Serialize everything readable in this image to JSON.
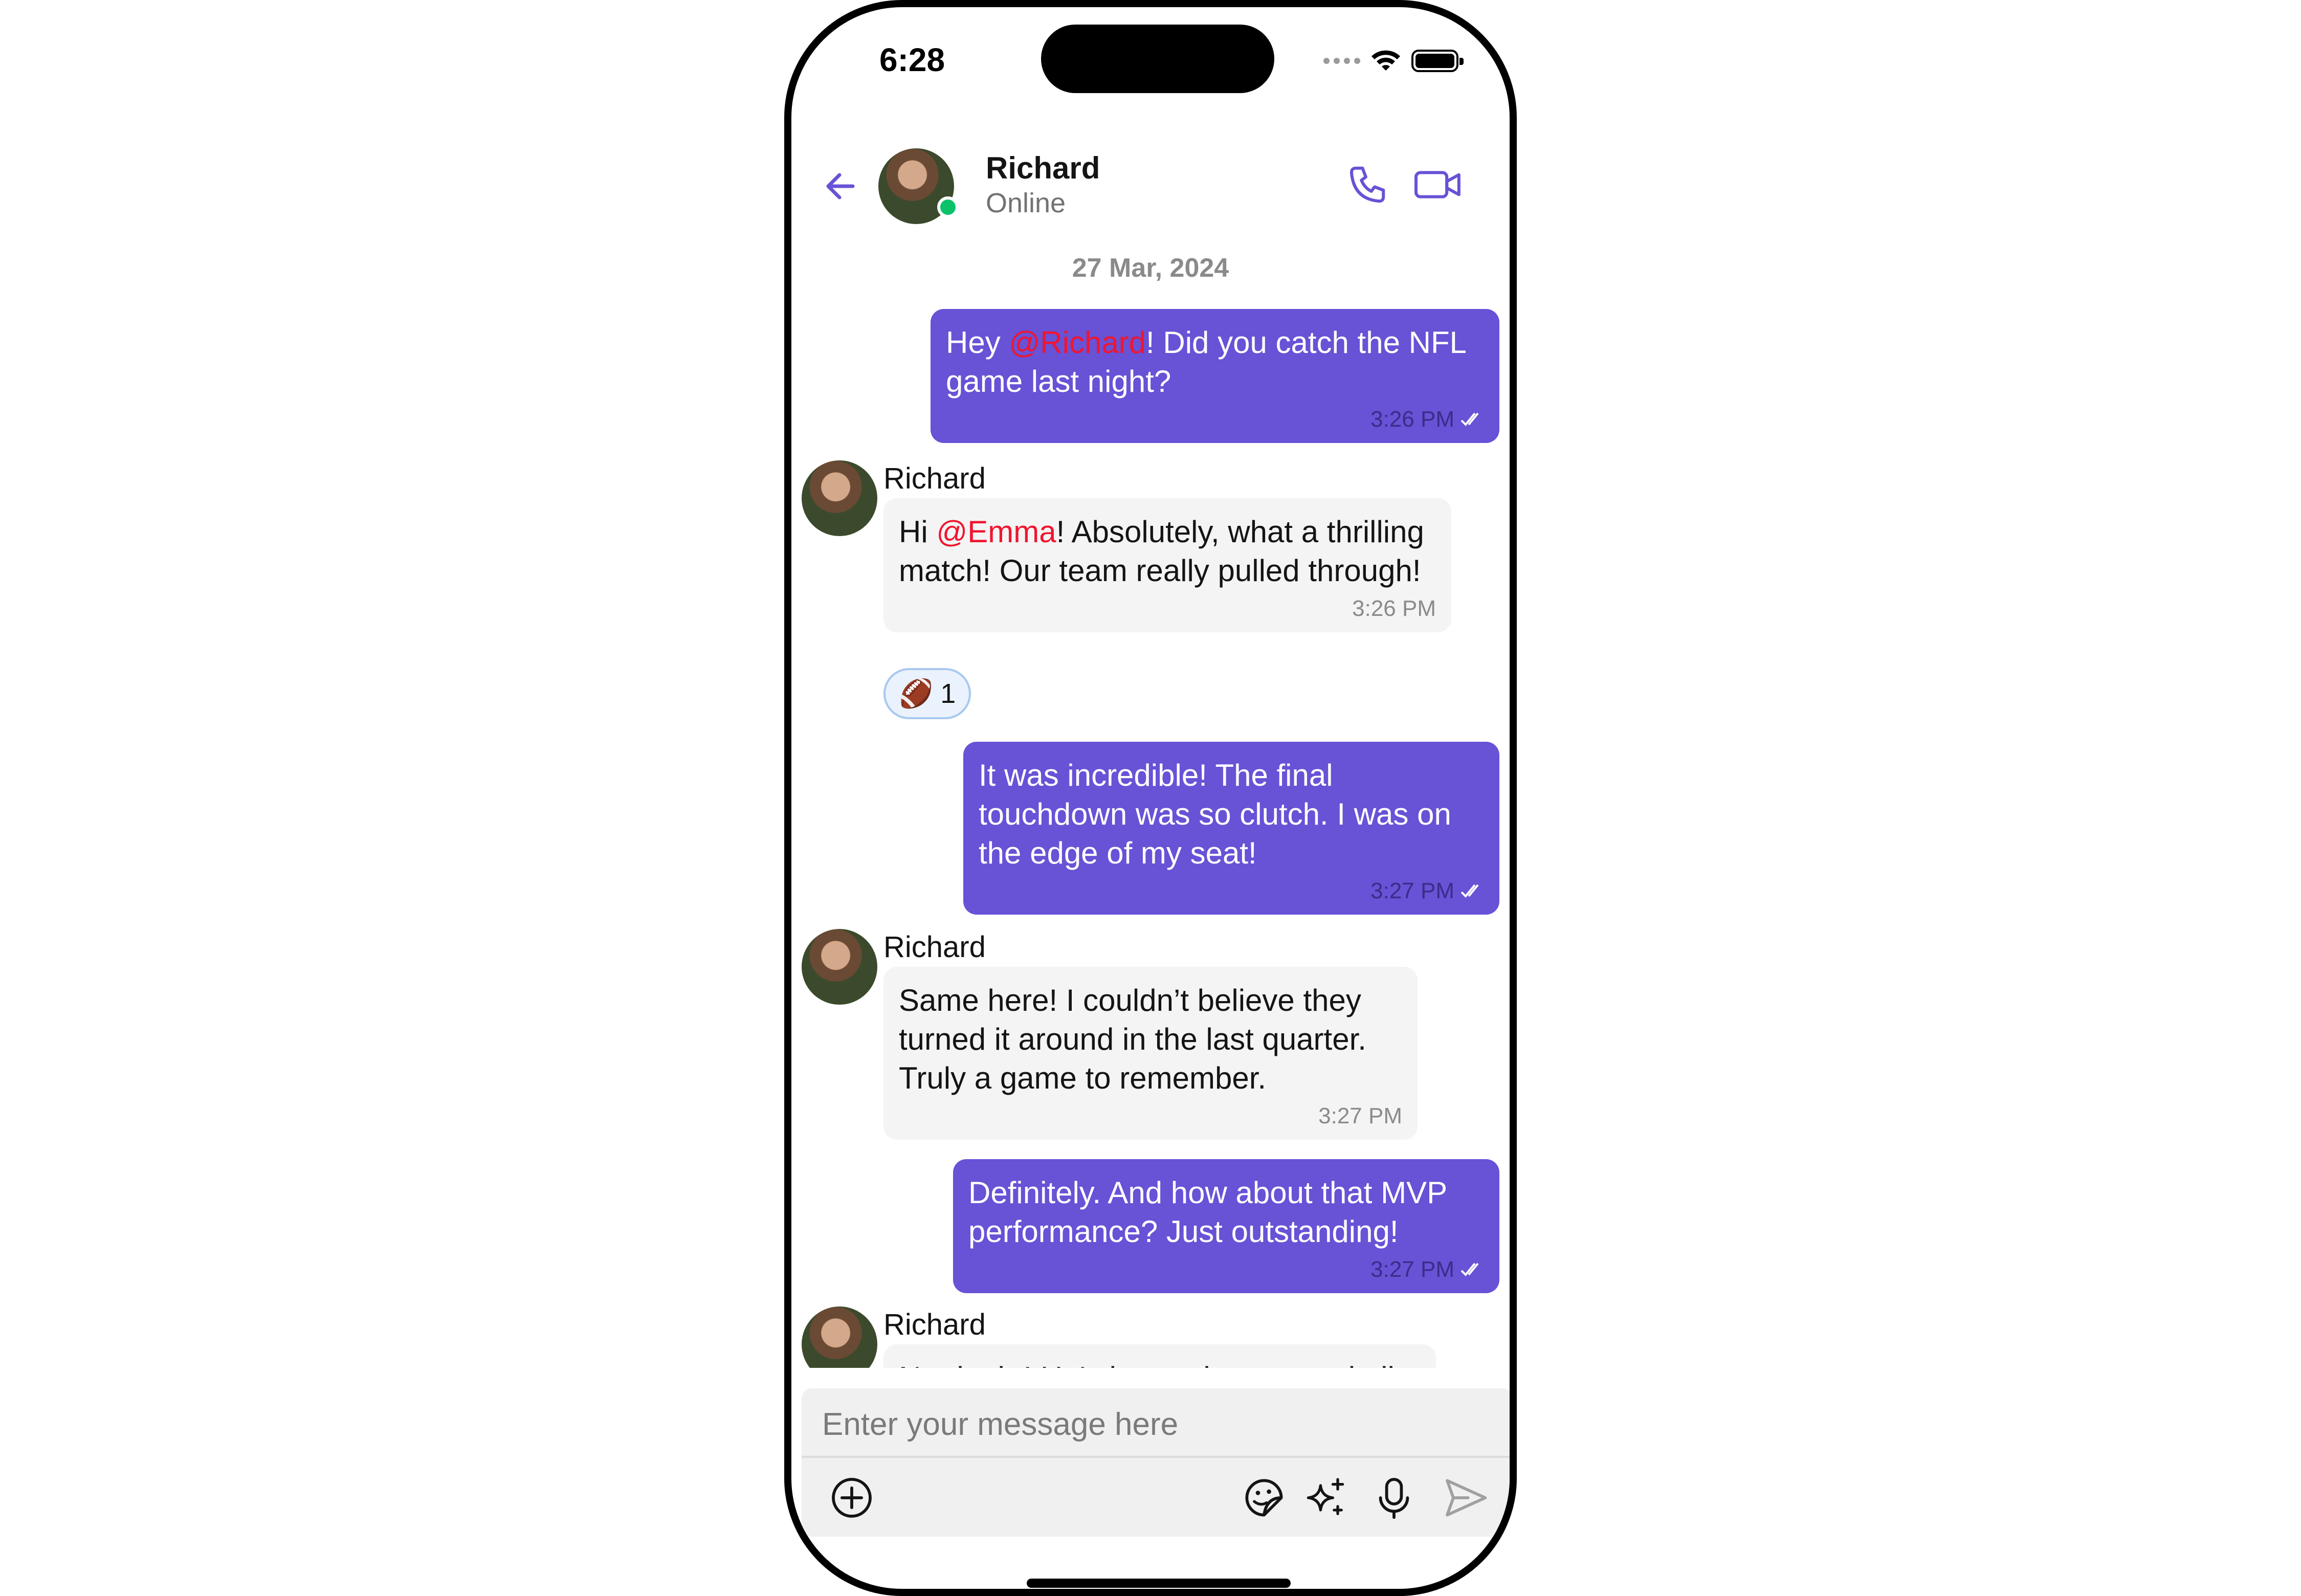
{
  "status_bar": {
    "time": "6:28"
  },
  "header": {
    "name": "Richard",
    "status": "Online"
  },
  "date_separator": "27 Mar, 2024",
  "messages": [
    {
      "direction": "outgoing",
      "parts": [
        "Hey ",
        "@Richard",
        "! Did you catch the NFL game last night?"
      ],
      "time": "3:26 PM",
      "read": true
    },
    {
      "direction": "incoming",
      "sender": "Richard",
      "parts": [
        "Hi ",
        "@Emma",
        "! Absolutely, what a thrilling match! Our team really pulled through!"
      ],
      "time": "3:26 PM",
      "reaction": {
        "emoji": "🏈",
        "count": "1"
      }
    },
    {
      "direction": "outgoing",
      "text": "It was incredible! The final touchdown was so clutch. I was on the edge of my seat!",
      "time": "3:27 PM",
      "read": true
    },
    {
      "direction": "incoming",
      "sender": "Richard",
      "text": "Same here! I couldn’t believe they turned it around in the last quarter. Truly a game to remember.",
      "time": "3:27 PM"
    },
    {
      "direction": "outgoing",
      "text": "Definitely. And how about that MVP performance? Just outstanding!",
      "time": "3:27 PM",
      "read": true
    },
    {
      "direction": "incoming",
      "sender": "Richard",
      "text": "No doubt! He's been phenomenal all"
    }
  ],
  "composer": {
    "placeholder": "Enter your message here",
    "icons": [
      "add-attachment-icon",
      "sticker-icon",
      "ai-sparkle-icon",
      "microphone-icon",
      "send-icon"
    ]
  },
  "colors": {
    "accent": "#6852d6",
    "mention": "#f0152f",
    "online": "#09c26a",
    "incoming_bubble": "#f4f4f4"
  }
}
